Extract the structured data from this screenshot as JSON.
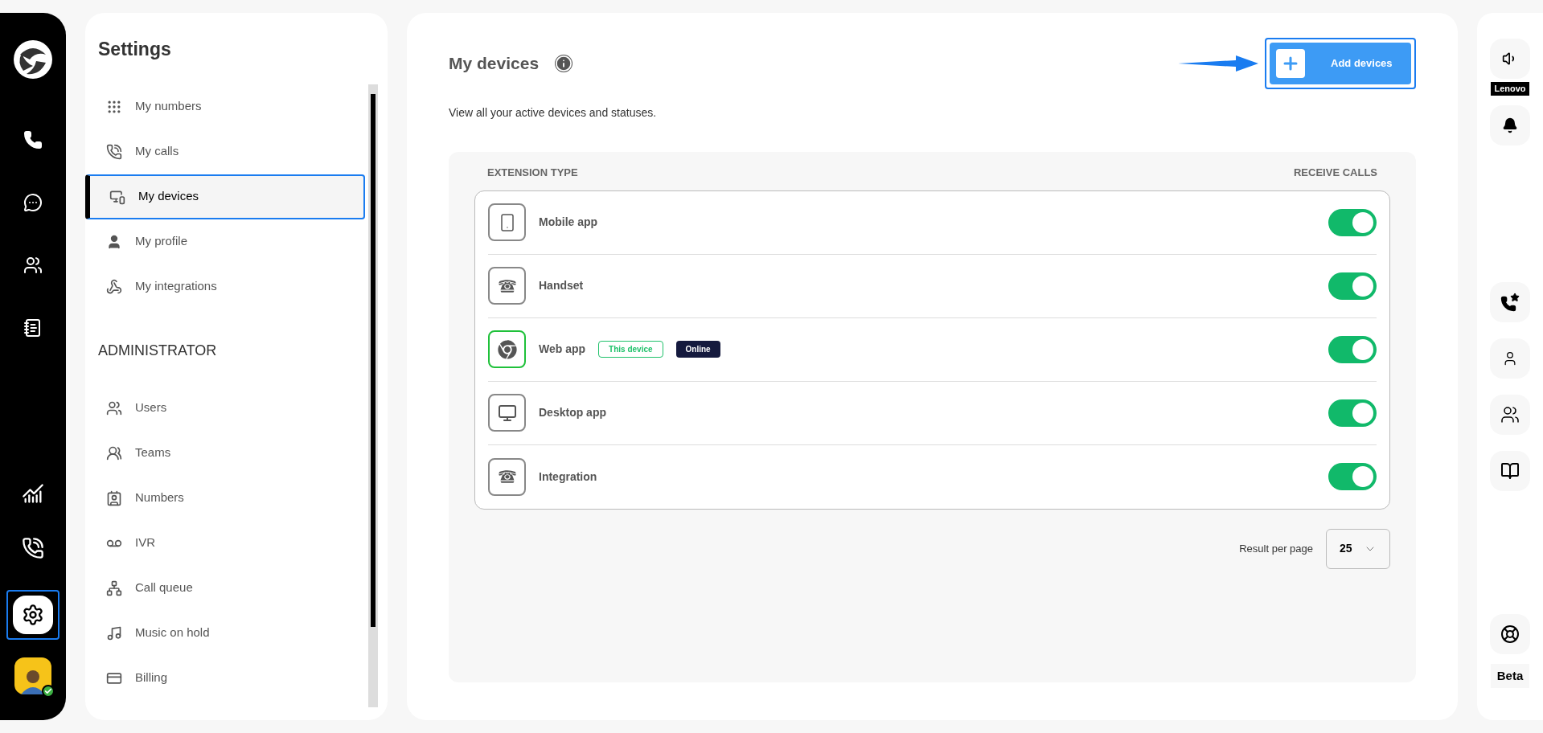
{
  "left_rail": [
    {
      "selected": false
    },
    {
      "selected": false
    },
    {
      "selected": false
    },
    {
      "selected": false
    },
    {
      "selected": false
    },
    {
      "selected": false
    },
    {
      "selected": true
    }
  ],
  "settings": {
    "title": "Settings",
    "items": [
      {
        "label": "My numbers",
        "selected": false
      },
      {
        "label": "My calls",
        "selected": false
      },
      {
        "label": "My devices",
        "selected": true
      },
      {
        "label": "My profile",
        "selected": false
      },
      {
        "label": "My integrations",
        "selected": false
      }
    ],
    "admin_title": "ADMINISTRATOR",
    "admin_items": [
      {
        "label": "Users",
        "selected": false
      },
      {
        "label": "Teams",
        "selected": false
      },
      {
        "label": "Numbers",
        "selected": false
      },
      {
        "label": "IVR",
        "selected": false
      },
      {
        "label": "Call queue",
        "selected": false
      },
      {
        "label": "Music on hold",
        "selected": false
      },
      {
        "label": "Billing",
        "selected": false
      }
    ]
  },
  "main": {
    "title": "My devices",
    "add_button": "Add devices",
    "description": "View all your active devices and statuses.",
    "columns": [
      "EXTENSION TYPE",
      "RECEIVE CALLS"
    ],
    "devices": [
      {
        "name": "Mobile app",
        "highlighted": false,
        "on": true
      },
      {
        "name": "Handset",
        "highlighted": false,
        "on": true
      },
      {
        "name": "Web app",
        "highlighted": true,
        "on": true,
        "badges": [
          {
            "label": "This device",
            "kind": "outline"
          },
          {
            "label": "Online",
            "kind": "filled"
          }
        ]
      },
      {
        "name": "Desktop app",
        "highlighted": false,
        "on": true
      },
      {
        "name": "Integration",
        "highlighted": false,
        "on": true
      }
    ],
    "per_page_label": "Result per page",
    "per_page_value": "25"
  },
  "right_rail": {
    "device_label": "Lenovo",
    "beta": "Beta"
  }
}
